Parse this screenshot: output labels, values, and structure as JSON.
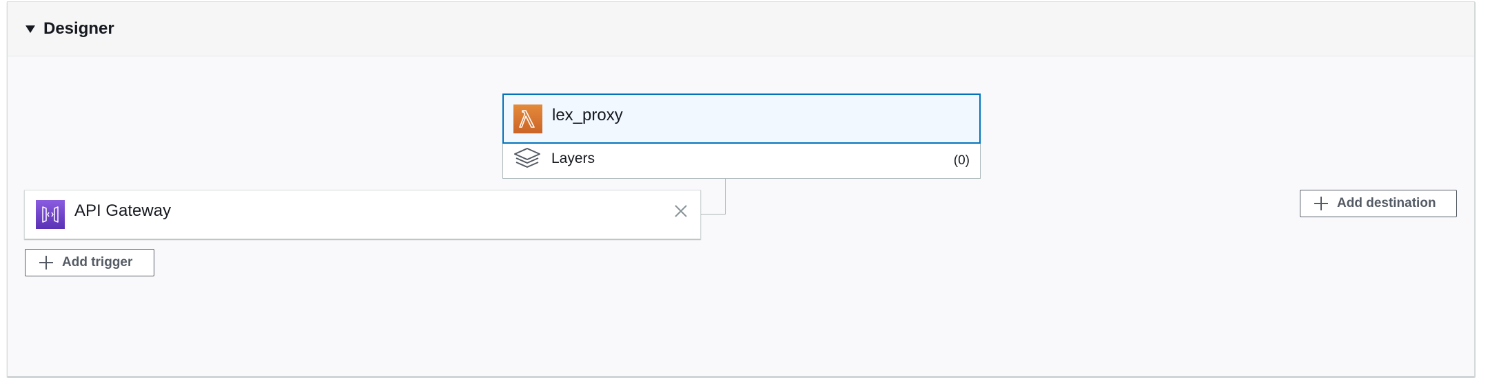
{
  "designer": {
    "title": "Designer",
    "toggle_icon": "caret-down-icon"
  },
  "function": {
    "name": "lex_proxy",
    "icon": "lambda-icon",
    "icon_color": "#d86613",
    "layers_label": "Layers",
    "layers_count": "(0)",
    "layers_icon": "layers-icon",
    "selected_border_color": "#0073bb"
  },
  "trigger": {
    "name": "API Gateway",
    "icon": "api-gateway-icon",
    "icon_color": "#693cc5",
    "remove_icon": "close-icon"
  },
  "buttons": {
    "add_trigger": "Add trigger",
    "add_destination": "Add destination"
  }
}
